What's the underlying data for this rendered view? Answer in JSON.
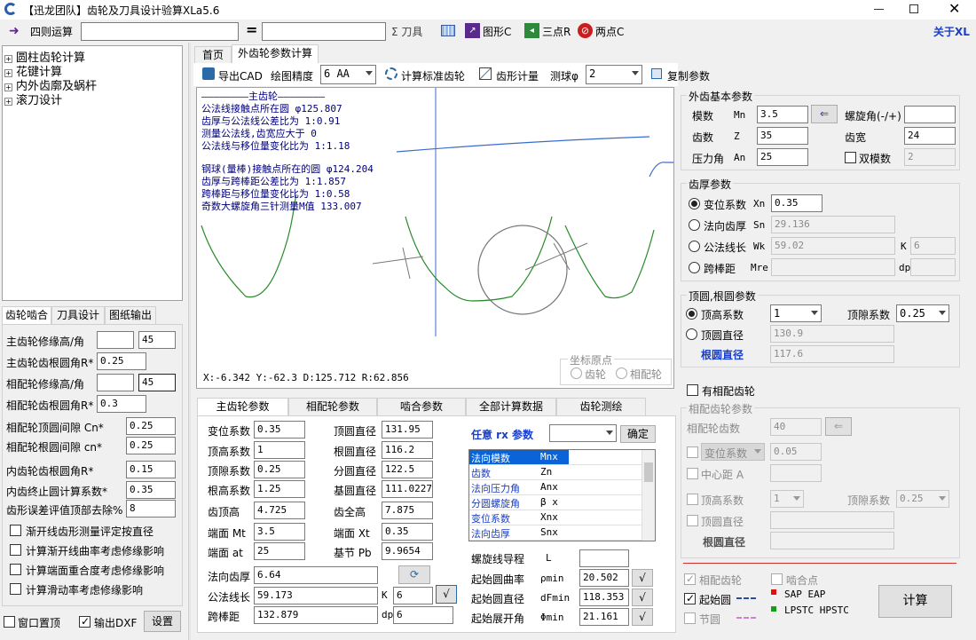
{
  "window": {
    "title": "【迅龙团队】齿轮及刀具设计验算XLa5.6"
  },
  "toolbar1": {
    "calc_label": "四则运算",
    "eq_sign": "=",
    "sigma_label": "Σ 刀具",
    "graph_label": "图形C",
    "three_point": "三点R",
    "two_point": "两点C",
    "about": "关于XL"
  },
  "tree": {
    "items": [
      "圆柱齿轮计算",
      "花键计算",
      "内外齿廓及蜗杆",
      "滚刀设计"
    ]
  },
  "left_tabs": [
    "齿轮啮合",
    "刀具设计",
    "图纸输出"
  ],
  "left_params": [
    {
      "label": "主齿轮修缘高/角",
      "v1": "",
      "v2": "45"
    },
    {
      "label": "主齿轮齿根圆角R*",
      "v1": "0.25"
    },
    {
      "label": "相配轮修缘高/角",
      "v1": "",
      "v2": "45"
    },
    {
      "label": "相配轮齿根圆角R*",
      "v1": "0.3"
    },
    {
      "label": "相配轮顶圆间隙   Cn*",
      "v1": "0.25"
    },
    {
      "label": "相配轮根圆间隙   cn*",
      "v1": "0.25"
    },
    {
      "label": "内齿轮齿根圆角R*",
      "v1": "0.15"
    },
    {
      "label": "内齿终止圆计算系数*",
      "v1": "0.35"
    },
    {
      "label": "齿形误差评值顶部去除%",
      "v1": "8"
    }
  ],
  "left_checks": [
    "渐开线齿形测量评定按直径",
    "计算渐开线曲率考虑修缘影响",
    "计算端面重合度考虑修缘影响",
    "计算滑动率考虑修缘影响"
  ],
  "bottom_left": {
    "topmost": "窗口置顶",
    "dxf": "输出DXF",
    "settings": "设置"
  },
  "main_tabs": [
    "首页",
    "外齿轮参数计算"
  ],
  "toolbar2": {
    "export": "导出CAD",
    "precision_label": "绘图精度",
    "precision_value": "6  AA",
    "calc_std": "计算标准齿轮",
    "measure": "齿形计量",
    "ball_label": "测球φ",
    "ball_value": "2",
    "copy": "复制参数"
  },
  "canvas": {
    "lines": [
      "————————主齿轮————————",
      "公法线接触点所在圆      φ125.807",
      "齿厚与公法线公差比为    1:0.91",
      "测量公法线,齿宽应大于    0",
      "公法线与移位量变化比为  1:1.18",
      "",
      "钢球(量棒)接触点所在的圆 φ124.204",
      "齿厚与跨棒距公差比为    1:1.857",
      "跨棒距与移位量变化比为  1:0.58",
      "奇数大螺旋角三针测量M值  133.007"
    ],
    "coords": "X:-6.342   Y:-62.3     D:125.712 R:62.856",
    "origin_title": "坐标原点",
    "origin_gear": "齿轮",
    "origin_mate": "相配轮"
  },
  "basic": {
    "title": "外齿基本参数",
    "module_label": "模数",
    "module_sym": "Mn",
    "module_val": "3.5",
    "helix_label": "螺旋角(-/+)",
    "helix_val": "",
    "teeth_label": "齿数",
    "teeth_sym": "Z",
    "teeth_val": "35",
    "width_label": "齿宽",
    "width_val": "24",
    "pa_label": "压力角",
    "pa_sym": "An",
    "pa_val": "25",
    "dual_label": "双模数",
    "dual_val": "2"
  },
  "thickness": {
    "title": "齿厚参数",
    "shift_label": "变位系数",
    "shift_sym": "Xn",
    "shift_val": "0.35",
    "normal_label": "法向齿厚",
    "normal_sym": "Sn",
    "normal_val": "29.136",
    "span_label": "公法线长",
    "span_sym": "Wk",
    "span_val": "59.02",
    "k_label": "K",
    "k_val": "6",
    "mdim_label": "跨棒距",
    "mdim_sym": "Mre",
    "mdim_val": "",
    "dp_label": "dp",
    "dp_val": ""
  },
  "tipcircle": {
    "title": "顶圆,根圆参数",
    "addendum_label": "顶高系数",
    "addendum_val": "1",
    "clear_label": "顶隙系数",
    "clear_val": "0.25",
    "tipdia_label": "顶圆直径",
    "tipdia_val": "130.9",
    "rootdia_label": "根圆直径",
    "rootdia_val": "117.6"
  },
  "mate": {
    "has_mate": "有相配齿轮",
    "title": "相配齿轮参数",
    "teeth_label": "相配轮齿数",
    "teeth_val": "40",
    "shift_label": "变位系数",
    "shift_val": "0.05",
    "center_label": "中心距 A",
    "center_val": "",
    "add_label": "顶高系数",
    "add_val": "1",
    "clear_label": "顶隙系数",
    "clear_val": "0.25",
    "tip_label": "顶圆直径",
    "root_label": "根圆直径"
  },
  "legend": {
    "mate_gear": "相配齿轮",
    "mesh_point": "啮合点",
    "start_circle": "起始圆",
    "pitch": "节圆",
    "sap": "SAP EAP",
    "lpstc": "LPSTC HPSTC",
    "calc_btn": "计算"
  },
  "lower_tabs": [
    "主齿轮参数",
    "相配轮参数",
    "啮合参数",
    "全部计算数据",
    "齿轮测绘"
  ],
  "results": [
    {
      "label": "变位系数",
      "val": "0.35",
      "label2": "顶圆直径",
      "val2": "131.95"
    },
    {
      "label": "顶高系数",
      "val": "1",
      "label2": "根圆直径",
      "val2": "116.2"
    },
    {
      "label": "顶隙系数",
      "val": "0.25",
      "label2": "分圆直径",
      "val2": "122.5"
    },
    {
      "label": "根高系数",
      "val": "1.25",
      "label2": "基圆直径",
      "val2": "111.0227"
    },
    {
      "label": "齿顶高",
      "val": "4.725",
      "label2": "齿全高",
      "val2": "7.875"
    },
    {
      "label": "端面 Mt",
      "val": "3.5",
      "label2": "端面 Xt",
      "val2": "0.35"
    },
    {
      "label": "端面 at",
      "val": "25",
      "label2": "基节 Pb",
      "val2": "9.9654"
    }
  ],
  "results2": {
    "normal_label": "法向齿厚",
    "normal_val": "6.64",
    "span_label": "公法线长",
    "span_val": "59.173",
    "k_label": "K",
    "k_val": "6",
    "mdim_label": "跨棒距",
    "mdim_val": "132.879",
    "dp_label": "dp",
    "dp_val": "6"
  },
  "anyparam": {
    "title": "任意 rx 参数",
    "ok": "确定",
    "rows": [
      {
        "name": "法向模数",
        "sym": "Mnx"
      },
      {
        "name": "齿数",
        "sym": "Zn"
      },
      {
        "name": "法向压力角",
        "sym": "Anx"
      },
      {
        "name": "分圆螺旋角",
        "sym": "β x"
      },
      {
        "name": "变位系数",
        "sym": "Xnx"
      },
      {
        "name": "法向齿厚",
        "sym": "Snx"
      }
    ]
  },
  "start": {
    "lead_label": "螺旋线导程",
    "lead_sym": "L",
    "lead_val": "",
    "curv_label": "起始圆曲率",
    "curv_sym": "ρmin",
    "curv_val": "20.502",
    "dia_label": "起始圆直径",
    "dia_sym": "dFmin",
    "dia_val": "118.353",
    "angle_label": "起始展开角",
    "angle_sym": "Φmin",
    "angle_val": "21.161"
  }
}
